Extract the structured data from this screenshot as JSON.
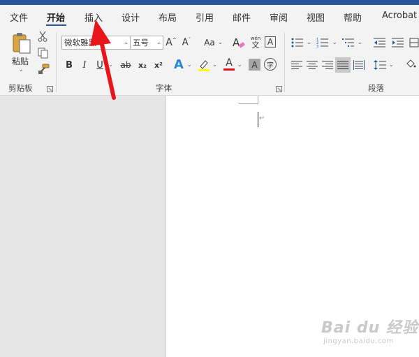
{
  "tabs": [
    {
      "label": "文件",
      "active": false
    },
    {
      "label": "开始",
      "active": true
    },
    {
      "label": "插入",
      "active": false
    },
    {
      "label": "设计",
      "active": false
    },
    {
      "label": "布局",
      "active": false
    },
    {
      "label": "引用",
      "active": false
    },
    {
      "label": "邮件",
      "active": false
    },
    {
      "label": "审阅",
      "active": false
    },
    {
      "label": "视图",
      "active": false
    },
    {
      "label": "帮助",
      "active": false
    },
    {
      "label": "Acrobat",
      "active": false
    }
  ],
  "clipboard": {
    "paste_label": "粘贴",
    "group_label": "剪贴板",
    "icons": [
      "paste-icon",
      "cut-icon",
      "copy-icon",
      "format-painter-icon"
    ]
  },
  "font": {
    "group_label": "字体",
    "font_name": "微软雅黑",
    "font_size": "五号",
    "change_case_label": "Aa",
    "bold_label": "B",
    "italic_label": "I",
    "underline_label": "U",
    "strike_label": "ab",
    "subscript_label": "x₂",
    "superscript_label": "x²",
    "text_effect_label": "A",
    "font_color_label": "A",
    "char_shading_label": "A",
    "enclose_label": "字",
    "phonetic_top": "wén",
    "phonetic_bottom": "文",
    "char_border_label": "A",
    "highlight_color": "#ffff00",
    "font_color": "#e81123"
  },
  "paragraph": {
    "group_label": "段落"
  },
  "watermark": {
    "main": "Bai du 经验",
    "sub": "jingyan.baidu.com"
  },
  "colors": {
    "accent": "#2b579a",
    "arrow": "#e8161b"
  }
}
